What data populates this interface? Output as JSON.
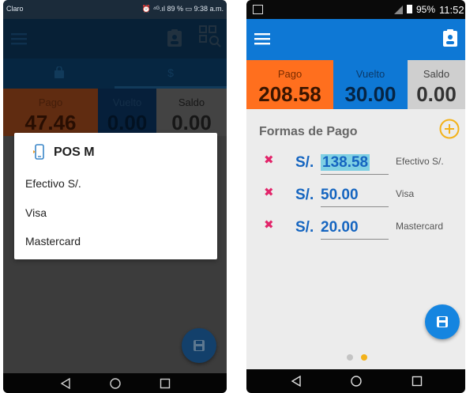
{
  "left": {
    "status": {
      "carrier": "Claro",
      "right": "⏰ ⁴ᴳ.ıl 89 % ▭ 9:38 a.m."
    },
    "tabs": [
      {
        "icon": "bag-icon"
      },
      {
        "label": "$"
      }
    ],
    "summary": [
      {
        "label": "Pago",
        "value": "47.46",
        "color": "#b0501f"
      },
      {
        "label": "Vuelto",
        "value": "0.00",
        "color": "#0c3a6a"
      },
      {
        "label": "Saldo",
        "value": "0.00",
        "color": "#7a7a7a"
      }
    ],
    "dialog": {
      "title": "POS M",
      "options": [
        "Efectivo S/.",
        "Visa",
        "Mastercard"
      ]
    }
  },
  "right": {
    "status": {
      "battery": "95%",
      "time": "11:52"
    },
    "summary": [
      {
        "label": "Pago",
        "value": "208.58",
        "color": "#ff6f1e"
      },
      {
        "label": "Vuelto",
        "value": "30.00",
        "color": "#0e78d5"
      },
      {
        "label": "Saldo",
        "value": "0.00",
        "color": "#cfcfcf"
      }
    ],
    "section_title": "Formas de Pago",
    "payments": [
      {
        "currency": "S/.",
        "amount": "138.58",
        "method": "Efectivo S/.",
        "selected": true
      },
      {
        "currency": "S/.",
        "amount": "50.00",
        "method": "Visa",
        "selected": false
      },
      {
        "currency": "S/.",
        "amount": "20.00",
        "method": "Mastercard",
        "selected": false
      }
    ]
  },
  "colors": {
    "accent_orange": "#ff6f1e",
    "primary_blue": "#0e78d5",
    "amount_blue": "#1565c0",
    "remove_red": "#e2256a"
  }
}
